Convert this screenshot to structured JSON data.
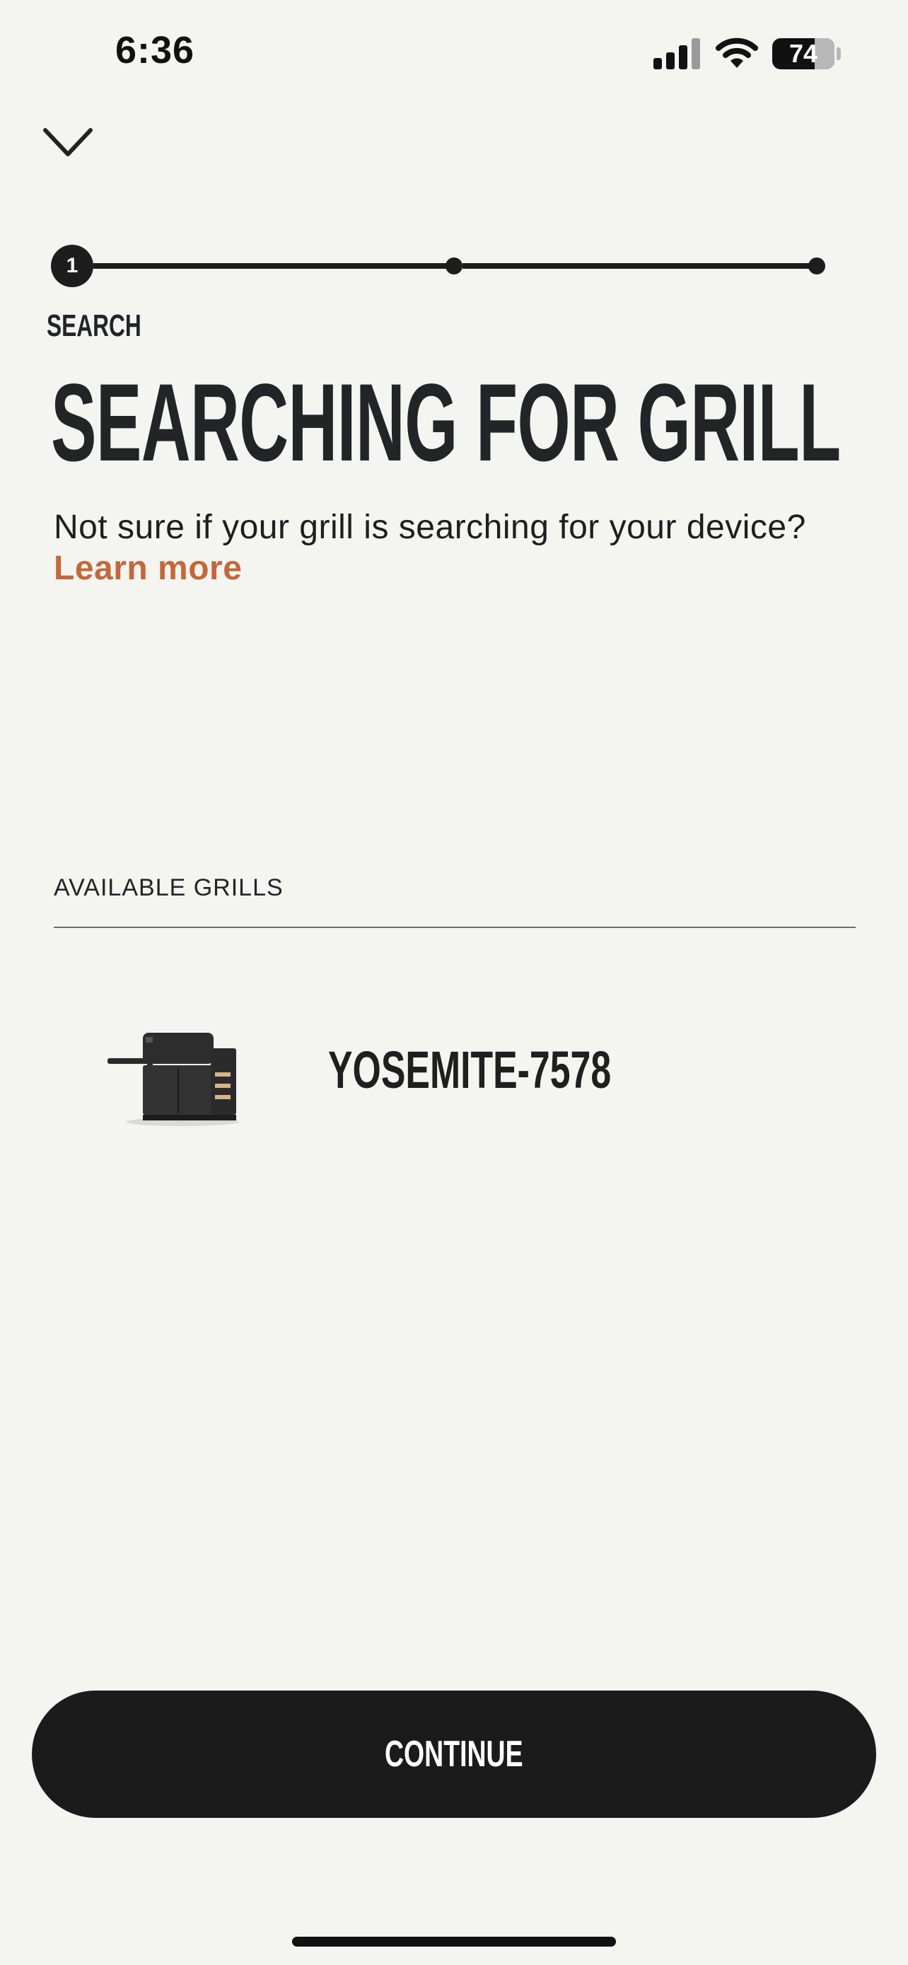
{
  "status_bar": {
    "time": "6:36",
    "battery": "74"
  },
  "stepper": {
    "current_step": "1",
    "label": "SEARCH"
  },
  "title": "SEARCHING FOR GRILL",
  "help": {
    "text": "Not sure if your grill is searching for your device?",
    "link": "Learn more"
  },
  "available": {
    "section_label": "AVAILABLE GRILLS",
    "grills": [
      {
        "name": "YOSEMITE-7578",
        "icon": "grill-icon"
      }
    ]
  },
  "continue_label": "CONTINUE",
  "colors": {
    "background": "#f4f4f1",
    "text": "#232427",
    "accent": "#c4673a",
    "button": "#1b1b1b"
  }
}
